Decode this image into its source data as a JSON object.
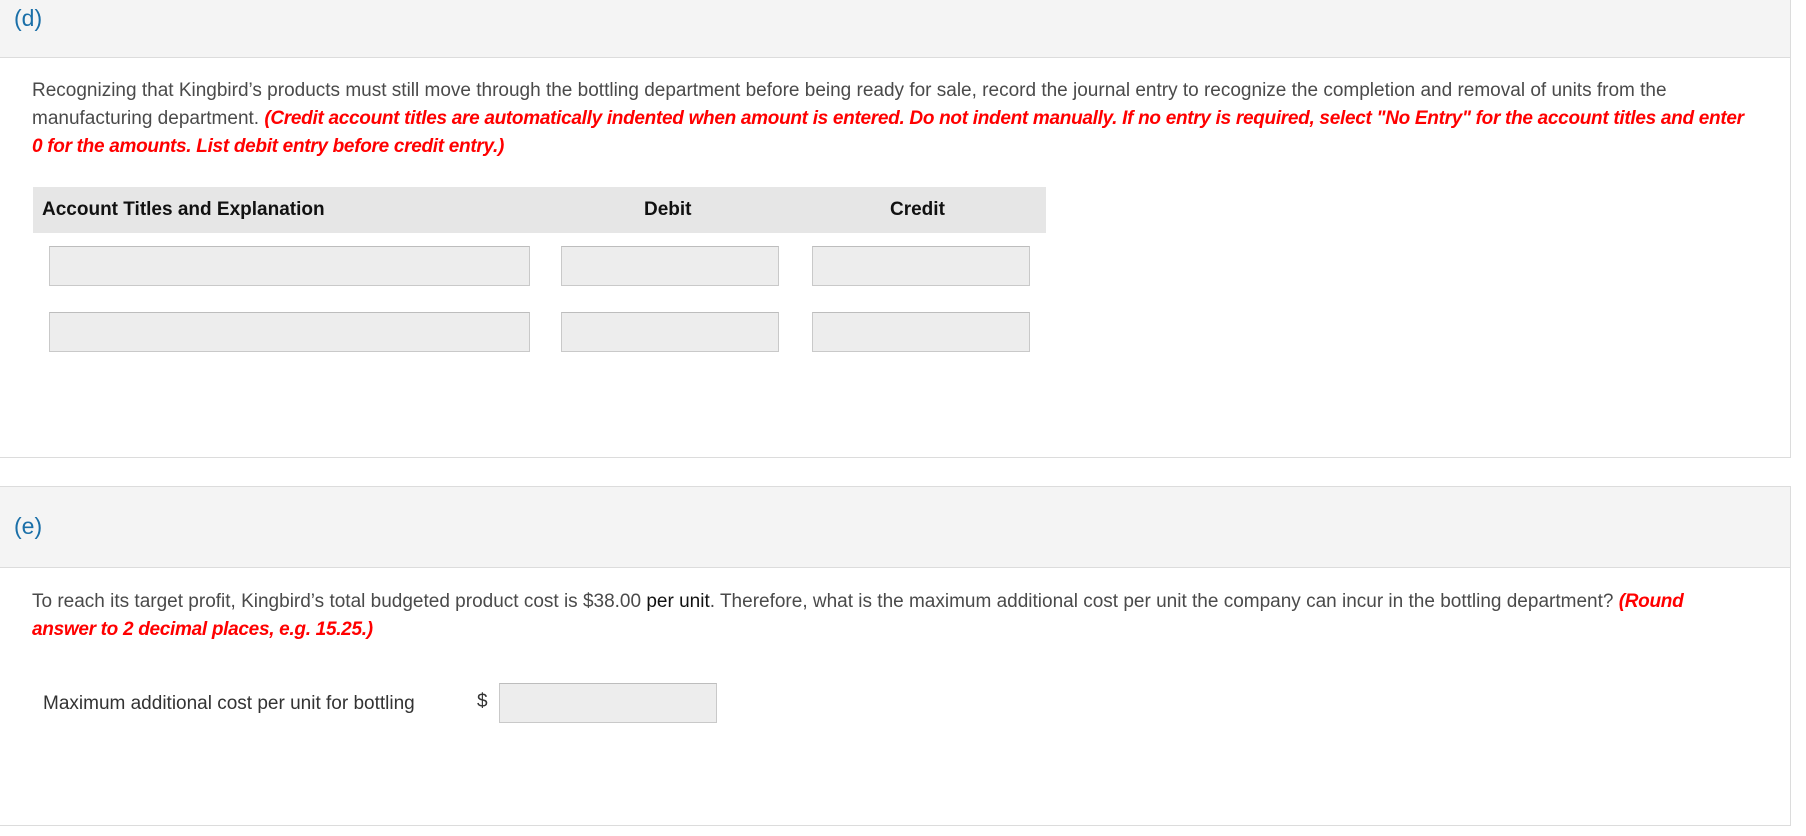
{
  "part_d": {
    "label": "(d)",
    "prompt_text": "Recognizing that Kingbird’s products must still move through the bottling department before being ready for sale, record the journal entry to recognize the completion and removal of units from the manufacturing department. ",
    "instruction": "(Credit account titles are automatically indented when amount is entered. Do not indent manually. If no entry is required, select \"No Entry\" for the account titles and enter 0 for the amounts. List debit entry before credit entry.)",
    "table": {
      "headers": {
        "account": "Account Titles and Explanation",
        "debit": "Debit",
        "credit": "Credit"
      },
      "rows": [
        {
          "account": "",
          "debit": "",
          "credit": ""
        },
        {
          "account": "",
          "debit": "",
          "credit": ""
        }
      ]
    }
  },
  "part_e": {
    "label": "(e)",
    "prompt_text_1": "To reach its target profit, Kingbird’s total budgeted product cost is $38.00 ",
    "prompt_emph": "per unit",
    "prompt_text_2": ". Therefore, what is the maximum additional cost per unit the company can incur in the bottling department? ",
    "instruction": "(Round answer to 2 decimal places, e.g. 15.25.)",
    "field_label": "Maximum additional cost per unit for bottling",
    "currency": "$",
    "field_value": ""
  }
}
